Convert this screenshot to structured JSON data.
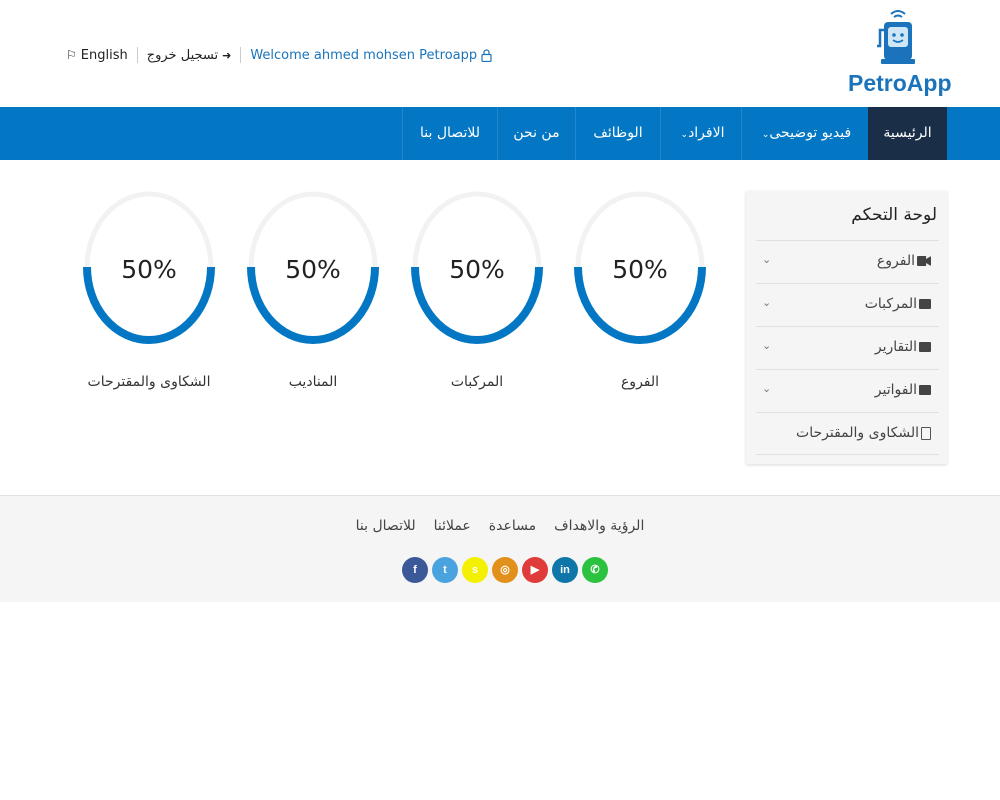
{
  "brand": {
    "name": "PetroApp",
    "color": "#1b74bb"
  },
  "top_links": {
    "language": "English",
    "logout": "تسجيل خروج",
    "welcome": "Welcome ahmed mohsen Petroapp"
  },
  "nav": {
    "items": [
      {
        "label": "الرئيسية",
        "active": true
      },
      {
        "label": "فيديو توضيحى",
        "dropdown": true
      },
      {
        "label": "الافراد",
        "dropdown": true
      },
      {
        "label": "الوظائف"
      },
      {
        "label": "من نحن"
      },
      {
        "label": "للاتصال بنا"
      }
    ],
    "color": "#0477c4",
    "active_color": "#1a2e47"
  },
  "sidebar": {
    "title": "لوحة التحكم",
    "items": [
      {
        "label": "الفروع",
        "icon": "video-camera-icon",
        "expandable": true
      },
      {
        "label": "المركبات",
        "icon": "briefcase-icon",
        "expandable": true
      },
      {
        "label": "التقارير",
        "icon": "briefcase-icon",
        "expandable": true
      },
      {
        "label": "الفواتير",
        "icon": "briefcase-icon",
        "expandable": true
      },
      {
        "label": "الشكاوى والمقترحات",
        "icon": "document-icon",
        "expandable": false
      }
    ]
  },
  "stats": [
    {
      "label": "الشكاوى والمقترحات",
      "percent_text": "50%",
      "value": 50
    },
    {
      "label": "المناديب",
      "percent_text": "50%",
      "value": 50
    },
    {
      "label": "المركبات",
      "percent_text": "50%",
      "value": 50
    },
    {
      "label": "الفروع",
      "percent_text": "50%",
      "value": 50
    }
  ],
  "footer": {
    "links": [
      "الرؤية والاهداف",
      "مساعدة",
      "عملائنا",
      "للاتصال بنا"
    ],
    "socials": [
      {
        "icon": "facebook-icon",
        "glyph": "f",
        "color": "#3b5998"
      },
      {
        "icon": "twitter-icon",
        "glyph": "t",
        "color": "#4aa3df"
      },
      {
        "icon": "snapchat-icon",
        "glyph": "s",
        "color": "#f3f000"
      },
      {
        "icon": "instagram-icon",
        "glyph": "◎",
        "color": "#e1901b"
      },
      {
        "icon": "youtube-icon",
        "glyph": "▶",
        "color": "#e03b3b"
      },
      {
        "icon": "linkedin-icon",
        "glyph": "in",
        "color": "#0e76a8"
      },
      {
        "icon": "whatsapp-icon",
        "glyph": "✆",
        "color": "#2bc23f"
      }
    ]
  }
}
